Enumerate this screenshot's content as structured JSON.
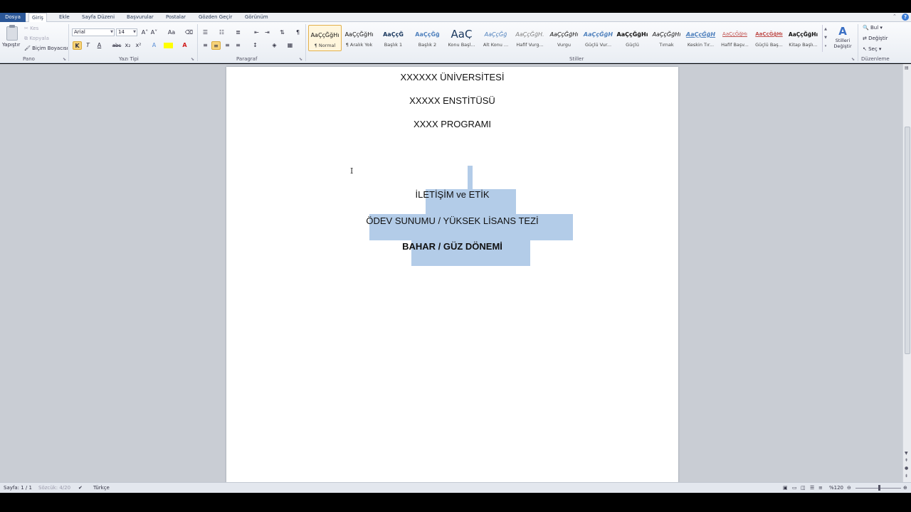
{
  "menu": {
    "tabs": [
      "Dosya",
      "Giriş",
      "Ekle",
      "Sayfa Düzeni",
      "Başvurular",
      "Postalar",
      "Gözden Geçir",
      "Görünüm"
    ],
    "active_tab": "Giriş",
    "help_label": "?"
  },
  "ribbon": {
    "clipboard": {
      "paste_label": "Yapıştır",
      "cut_label": "Kes",
      "copy_label": "Kopyala",
      "format_painter_label": "Biçim Boyacısı",
      "group_label": "Pano"
    },
    "font": {
      "font_name": "Arial",
      "font_size": "14",
      "group_label": "Yazı Tipi",
      "bold_label": "K",
      "italic_label": "T",
      "underline_label": "A",
      "strike_label": "abc",
      "subscript_label": "x₂",
      "superscript_label": "x²",
      "grow_label": "A˄",
      "shrink_label": "A˅",
      "case_label": "Aa",
      "clear_label": "A"
    },
    "paragraph": {
      "group_label": "Paragraf",
      "pilcrow_label": "¶"
    },
    "styles": {
      "group_label": "Stiller",
      "change_styles_label_1": "Stilleri",
      "change_styles_label_2": "Değiştir",
      "items": [
        {
          "sample": "AaÇçĞğHı",
          "name": "¶ Normal"
        },
        {
          "sample": "AaÇçĞğHı",
          "name": "¶ Aralık Yok"
        },
        {
          "sample": "AaÇçĞ",
          "name": "Başlık 1"
        },
        {
          "sample": "AaÇçĞğ",
          "name": "Başlık 2"
        },
        {
          "sample": "AaÇ",
          "name": "Konu Başl..."
        },
        {
          "sample": "AaÇçĞğ",
          "name": "Alt Konu ..."
        },
        {
          "sample": "AaÇçĞğH.",
          "name": "Hafif Vurg..."
        },
        {
          "sample": "AaÇçĞğHı",
          "name": "Vurgu"
        },
        {
          "sample": "AaÇçĞğH",
          "name": "Güçlü Vur..."
        },
        {
          "sample": "AaÇçĞğHı",
          "name": "Güçlü"
        },
        {
          "sample": "AaÇçĞğHı",
          "name": "Tırnak"
        },
        {
          "sample": "AaÇçĞğH",
          "name": "Keskin Tır..."
        },
        {
          "sample": "AaÇçĞğHı",
          "name": "Hafif Başv..."
        },
        {
          "sample": "AaÇçĞğHı",
          "name": "Güçlü Baş..."
        },
        {
          "sample": "AaÇçĞğHı",
          "name": "Kitap Başlı..."
        }
      ],
      "selected_index": 0
    },
    "editing": {
      "find_label": "Bul",
      "replace_label": "Değiştir",
      "select_label": "Seç",
      "group_label": "Düzenleme"
    }
  },
  "document": {
    "lines": [
      "XXXXXX ÜNİVERSİTESİ",
      "XXXXX ENSTİTÜSÜ",
      "XXXX PROGRAMI",
      "İLETİŞİM ve ETİK",
      "ÖDEV SUNUMU / YÜKSEK LİSANS TEZİ",
      "BAHAR / GÜZ DÖNEMİ"
    ]
  },
  "status": {
    "page": "Sayfa: 1 / 1",
    "words": "Sözcük: 4/20",
    "language": "Türkçe",
    "zoom": "%120"
  }
}
